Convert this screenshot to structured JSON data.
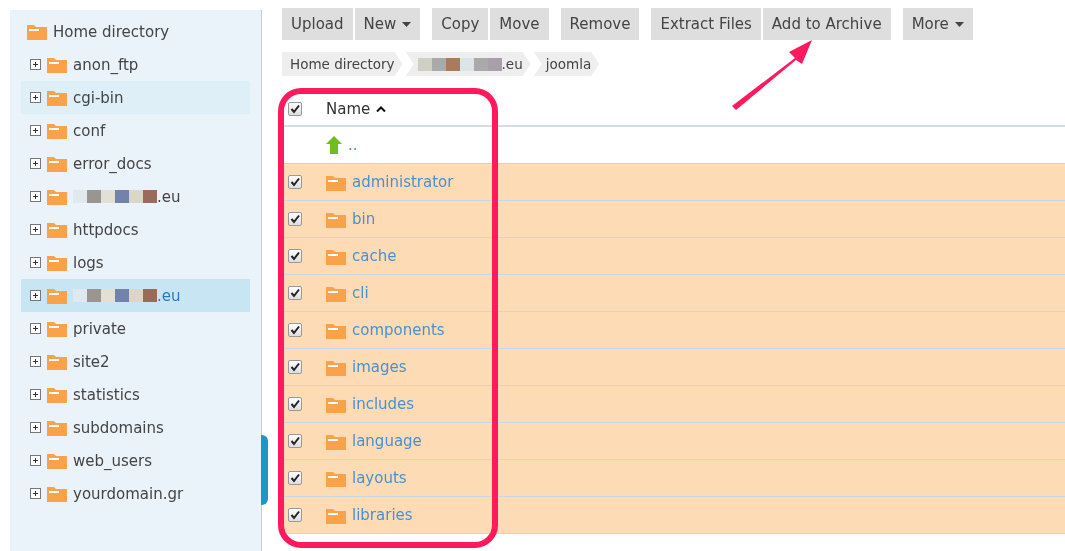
{
  "sidebar": {
    "root": {
      "label": "Home directory"
    },
    "items": [
      {
        "label": "anon_ftp",
        "redacted": false,
        "hovered": false,
        "selected": false
      },
      {
        "label": "cgi-bin",
        "redacted": false,
        "hovered": true,
        "selected": false
      },
      {
        "label": "conf",
        "redacted": false,
        "hovered": false,
        "selected": false
      },
      {
        "label": "error_docs",
        "redacted": false,
        "hovered": false,
        "selected": false
      },
      {
        "label": ".eu",
        "redacted": true,
        "hovered": false,
        "selected": false
      },
      {
        "label": "httpdocs",
        "redacted": false,
        "hovered": false,
        "selected": false
      },
      {
        "label": "logs",
        "redacted": false,
        "hovered": false,
        "selected": false
      },
      {
        "label": ".eu",
        "redacted": true,
        "hovered": false,
        "selected": true
      },
      {
        "label": "private",
        "redacted": false,
        "hovered": false,
        "selected": false
      },
      {
        "label": "site2",
        "redacted": false,
        "hovered": false,
        "selected": false
      },
      {
        "label": "statistics",
        "redacted": false,
        "hovered": false,
        "selected": false
      },
      {
        "label": "subdomains",
        "redacted": false,
        "hovered": false,
        "selected": false
      },
      {
        "label": "web_users",
        "redacted": false,
        "hovered": false,
        "selected": false
      },
      {
        "label": "yourdomain.gr",
        "redacted": false,
        "hovered": false,
        "selected": false
      }
    ]
  },
  "toolbar": {
    "groups": [
      [
        {
          "label": "Upload",
          "dropdown": false
        },
        {
          "label": "New",
          "dropdown": true
        }
      ],
      [
        {
          "label": "Copy",
          "dropdown": false
        },
        {
          "label": "Move",
          "dropdown": false
        }
      ],
      [
        {
          "label": "Remove",
          "dropdown": false
        }
      ],
      [
        {
          "label": "Extract Files",
          "dropdown": false
        },
        {
          "label": "Add to Archive",
          "dropdown": false
        }
      ],
      [
        {
          "label": "More",
          "dropdown": true
        }
      ]
    ]
  },
  "breadcrumb": [
    {
      "label": "Home directory",
      "redacted": false
    },
    {
      "label": ".eu",
      "redacted": true
    },
    {
      "label": "joomla",
      "redacted": false
    }
  ],
  "table": {
    "header": {
      "checked": true,
      "column": "Name",
      "sort_ascending": true
    },
    "parent_row": {
      "label": ".."
    },
    "rows": [
      {
        "name": "administrator",
        "checked": true
      },
      {
        "name": "bin",
        "checked": true
      },
      {
        "name": "cache",
        "checked": true
      },
      {
        "name": "cli",
        "checked": true
      },
      {
        "name": "components",
        "checked": true
      },
      {
        "name": "images",
        "checked": true
      },
      {
        "name": "includes",
        "checked": true
      },
      {
        "name": "language",
        "checked": true
      },
      {
        "name": "layouts",
        "checked": true
      },
      {
        "name": "libraries",
        "checked": true
      }
    ]
  },
  "annotations": {
    "highlight_box": true,
    "arrow": true
  }
}
